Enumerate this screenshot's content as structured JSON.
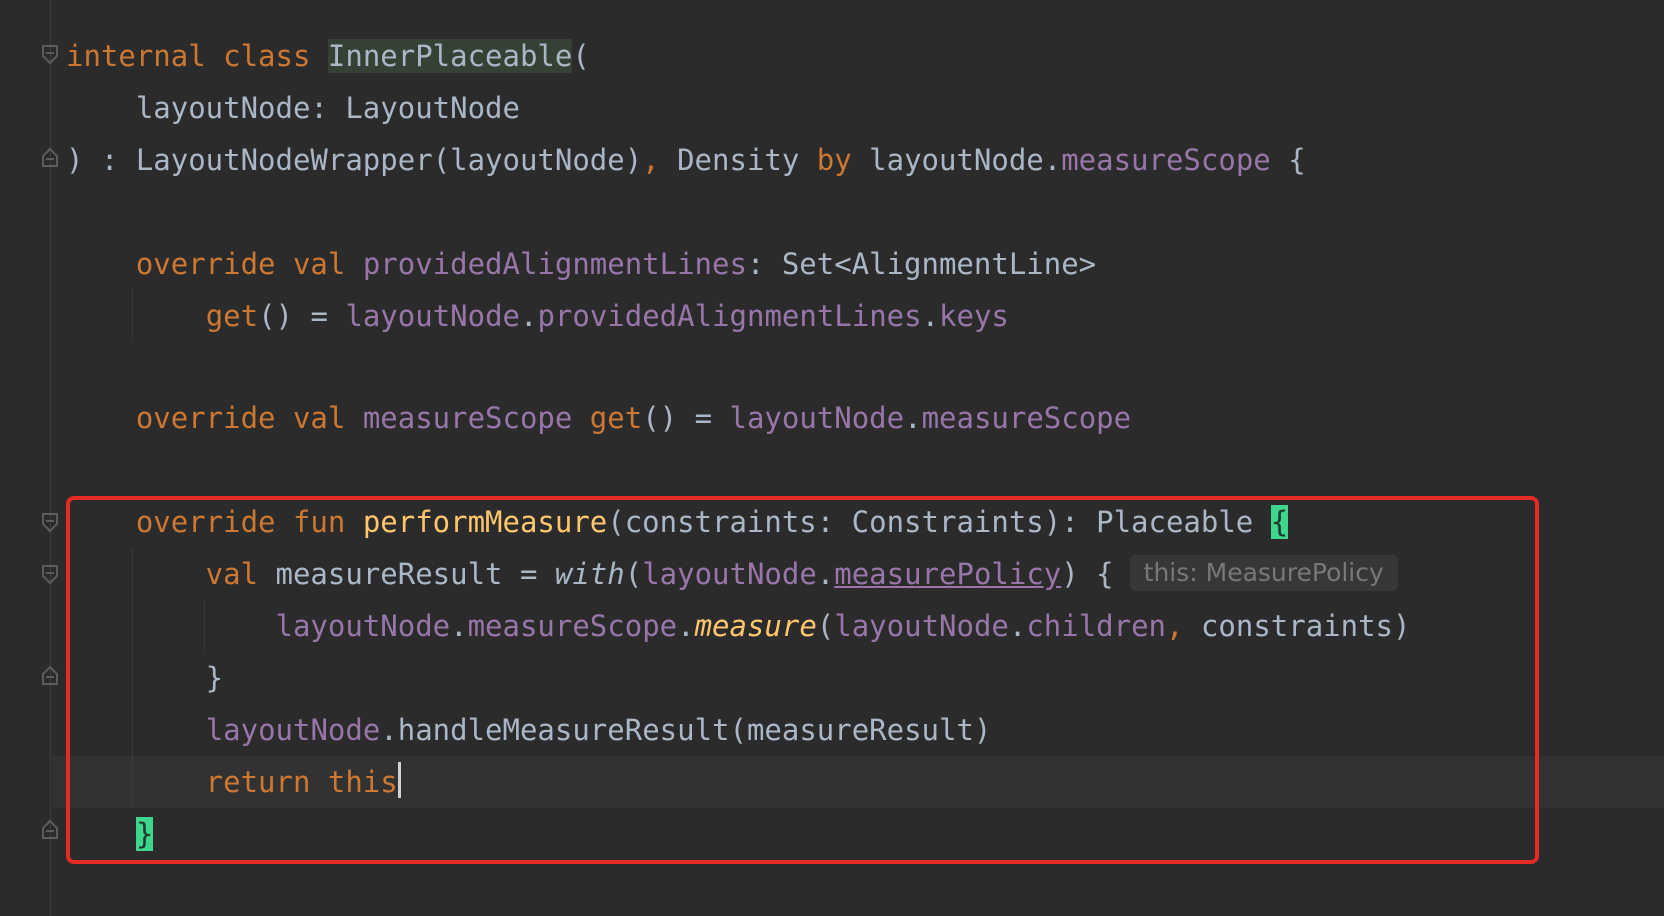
{
  "code": {
    "line1": {
      "kw": "internal class ",
      "cls": "InnerPlaceable",
      "rest": "("
    },
    "line2": {
      "text": "    layoutNode: LayoutNode"
    },
    "line3": {
      "pre": ") : LayoutNodeWrapper(layoutNode)",
      "comma": ",",
      "mid": " Density ",
      "by": "by",
      "sp": " layoutNode.",
      "prop": "measureScope",
      "end": " {"
    },
    "line5": {
      "kw": "    override val ",
      "prop": "providedAlignmentLines",
      "rest": ": Set<AlignmentLine>"
    },
    "line6": {
      "indent": "        ",
      "fn": "get",
      "mid": "() = ",
      "prop1": "layoutNode",
      "dot": ".",
      "prop2": "providedAlignmentLines",
      "dot2": ".",
      "prop3": "keys"
    },
    "line8": {
      "kw": "    override val ",
      "prop": "measureScope",
      "sp": " ",
      "fn": "get",
      "mid": "() = ",
      "prop1": "layoutNode",
      "dot": ".",
      "prop2": "measureScope"
    },
    "line10": {
      "kw": "    override fun ",
      "fn": "performMeasure",
      "rest": "(constraints: Constraints): Placeable ",
      "brace": "{"
    },
    "line11": {
      "kw": "        val ",
      "mid": "measureResult = ",
      "with": "with",
      "paren": "(",
      "prop1": "layoutNode",
      "dot": ".",
      "prop2": "measurePolicy",
      "end": ") {",
      "hint": "this: MeasurePolicy"
    },
    "line12": {
      "indent": "            ",
      "prop1": "layoutNode",
      "dot": ".",
      "prop2": "measureScope",
      "dot2": ".",
      "fn": "measure",
      "paren": "(",
      "prop3": "layoutNode",
      "dot3": ".",
      "prop4": "children",
      "comma": ",",
      "end": " constraints)"
    },
    "line13": {
      "text": "        }"
    },
    "line14": {
      "indent": "        ",
      "prop": "layoutNode",
      "rest": ".handleMeasureResult(measureResult)"
    },
    "line15": {
      "kw": "        return this"
    },
    "line16": {
      "indent": "    ",
      "brace": "}"
    }
  },
  "colors": {
    "background": "#2b2b2b",
    "keyword": "#cc7832",
    "property": "#9876aa",
    "function": "#ffc66d",
    "highlight_border": "#e62a24",
    "brace_match": "#3dd68c"
  }
}
